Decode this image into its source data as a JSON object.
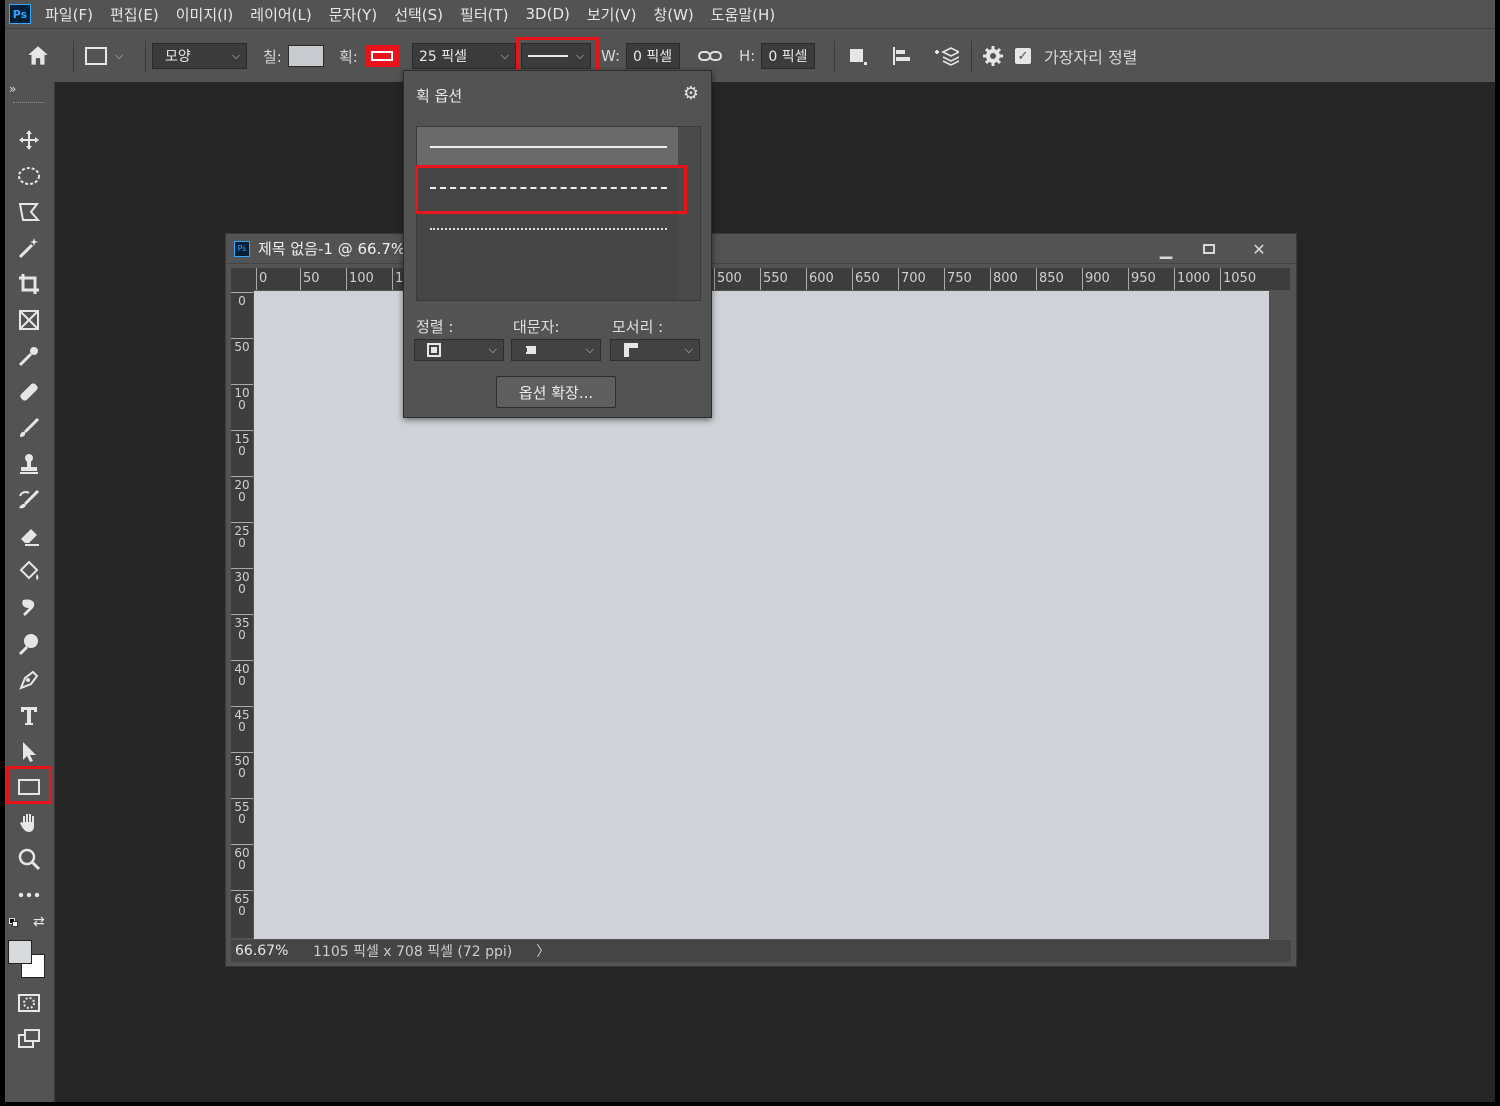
{
  "app": {
    "logo": "Ps"
  },
  "menu": [
    "파일(F)",
    "편집(E)",
    "이미지(I)",
    "레이어(L)",
    "문자(Y)",
    "선택(S)",
    "필터(T)",
    "3D(D)",
    "보기(V)",
    "창(W)",
    "도움말(H)"
  ],
  "options": {
    "mode_value": "모양",
    "fill_label": "칠:",
    "stroke_label": "획:",
    "stroke_width": "25 픽셀",
    "w_label": "W:",
    "w_value": "0 픽셀",
    "h_label": "H:",
    "h_value": "0 픽셀",
    "align_edges_label": "가장자리 정렬",
    "align_edges_checked": true
  },
  "document": {
    "title": "제목 없음-1 @ 66.7%",
    "zoom": "66.67%",
    "info": "1105 픽셀 x 708 픽셀 (72 ppi)",
    "status_arrow": "〉",
    "hruler": [
      "0",
      "50",
      "100",
      "1",
      "500",
      "550",
      "600",
      "650",
      "700",
      "750",
      "800",
      "850",
      "900",
      "950",
      "1000",
      "1050"
    ],
    "vruler": [
      "0",
      "50",
      "100",
      "150",
      "200",
      "250",
      "300",
      "350",
      "400",
      "450",
      "500",
      "550",
      "600",
      "650"
    ]
  },
  "stroke_popup": {
    "title": "획 옵션",
    "align_label": "정렬 :",
    "caps_label": "대문자:",
    "corners_label": "모서리 :",
    "more_button": "옵션 확장..."
  },
  "colors": {
    "highlight": "#e8141c",
    "canvas": "#cfd3d7",
    "ui_panel": "#535353",
    "workspace": "#262626",
    "ps_blue": "#31a8ff"
  }
}
